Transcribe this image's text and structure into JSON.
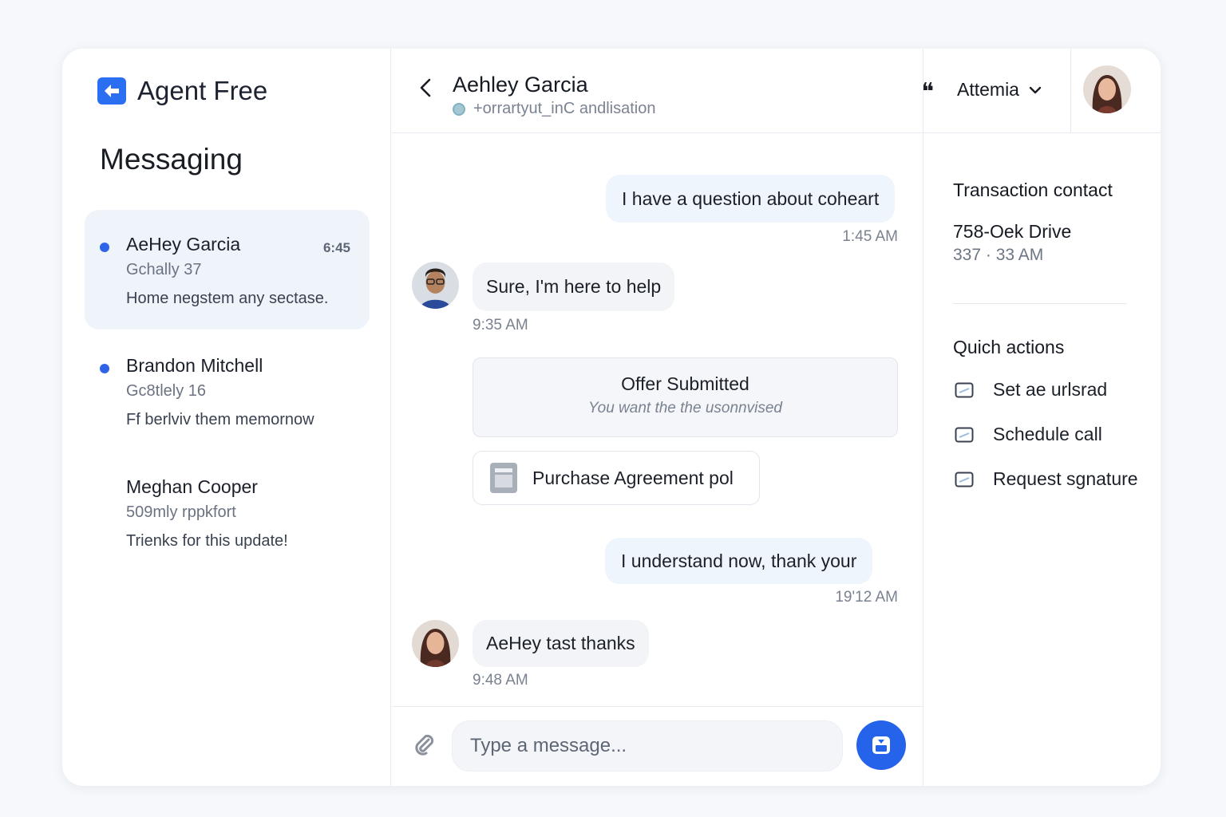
{
  "brand": {
    "name": "Agent Free"
  },
  "sidebar": {
    "title": "Messaging",
    "conversations": [
      {
        "name": "AeHey Garcia",
        "time": "6:45",
        "sub": "Gchally 37",
        "preview": "Home negstem any sectase.",
        "unread": true,
        "active": true
      },
      {
        "name": "Brandon Mitchell",
        "time": "",
        "sub": "Gc8tlely 16",
        "preview": "Ff berlviv them memornow",
        "unread": true,
        "active": false
      },
      {
        "name": "Meghan Cooper",
        "time": "",
        "sub": "509mly rppkfort",
        "preview": "Trienks for this update!",
        "unread": false,
        "active": false
      }
    ]
  },
  "header": {
    "contact_name": "Aehley Garcia",
    "contact_status": "+orrartyut_inC andlisation",
    "agent_label": "Attemia"
  },
  "chat": {
    "messages": [
      {
        "text": "I have a question about coheart",
        "time": "1:45 AM"
      },
      {
        "text": "Sure, I'm here to help",
        "time": "9:35 AM"
      },
      {
        "text": "I understand now, thank your",
        "time": "19'12 AM"
      },
      {
        "text": "AeHey tast thanks",
        "time": "9:48 AM"
      }
    ],
    "offer": {
      "title": "Offer Submitted",
      "subtitle": "You want the the usonnvised"
    },
    "file": {
      "name": "Purchase Agreement pol"
    },
    "composer": {
      "placeholder": "Type a message..."
    }
  },
  "details": {
    "title": "Transaction contact",
    "address": "758-Oek Drive",
    "meta": "337 · 33 AM",
    "quick_title": "Quich actions",
    "actions": [
      {
        "label": "Set ae urlsrad"
      },
      {
        "label": "Schedule call"
      },
      {
        "label": "Request sgnature"
      }
    ]
  },
  "colors": {
    "accent": "#2563eb",
    "unread_dot": "#2f64e8",
    "outgoing_bubble": "#eef5fc",
    "incoming_bubble": "#f2f4f7"
  }
}
